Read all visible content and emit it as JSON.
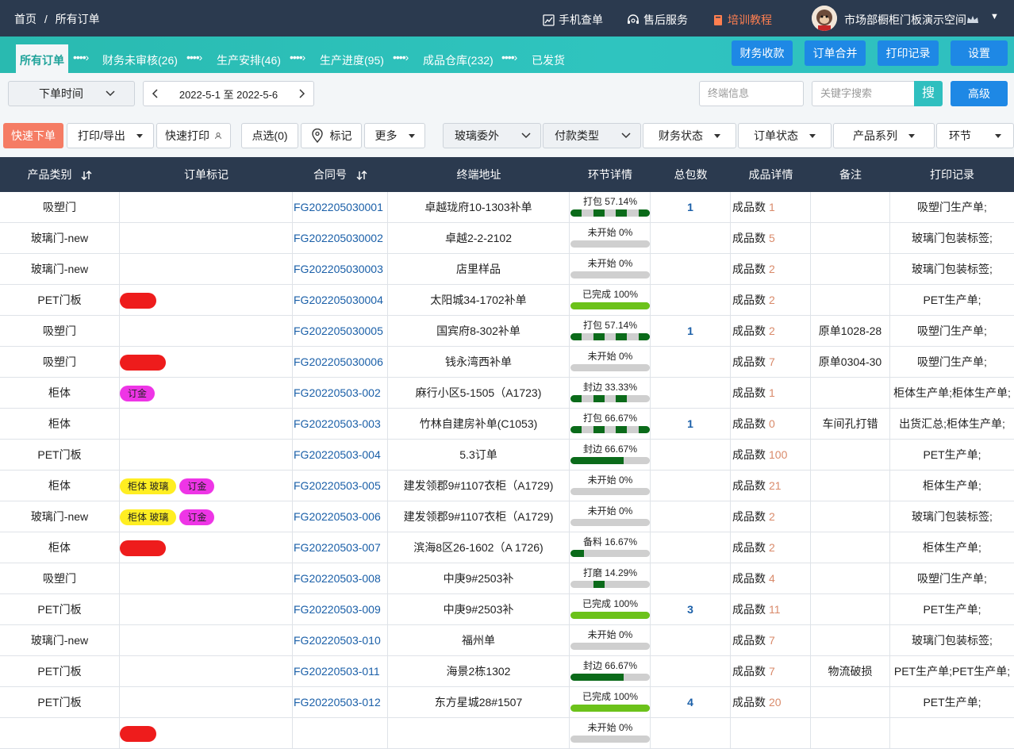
{
  "top": {
    "breadcrumb": [
      "首页",
      "/",
      "所有订单"
    ],
    "mobile": "手机查单",
    "service": "售后服务",
    "training": "培训教程",
    "user": "市场部橱柜门板演示空间"
  },
  "flow": {
    "steps": [
      {
        "label": "所有订单"
      },
      {
        "label": "财务未审核(26)"
      },
      {
        "label": "生产安排(46)"
      },
      {
        "label": "生产进度(95)"
      },
      {
        "label": "成品仓库(232)"
      },
      {
        "label": "已发货"
      }
    ],
    "buttons": [
      "财务收款",
      "订单合并",
      "打印记录",
      "设置"
    ]
  },
  "filter": {
    "time_type": "下单时间",
    "date_range": "2022-5-1 至 2022-5-6",
    "terminal_placeholder": "终端信息",
    "keyword_placeholder": "关键字搜索",
    "search_label": "搜",
    "advanced": "高级"
  },
  "actions": {
    "quick_order": "快速下单",
    "print_export": "打印/导出",
    "quick_print": "快速打印",
    "select": "点选(0)",
    "mark": "标记",
    "more": "更多",
    "glass": "玻璃委外",
    "pay_type": "付款类型",
    "finance_status": "财务状态",
    "order_status": "订单状态",
    "product_series": "产品系列",
    "stage": "环节"
  },
  "colors": {
    "header": "#2b3a4f",
    "flow_start": "#29bab0",
    "primary_button": "#1e88e5",
    "quick_order": "#f57c64",
    "progress_dark": "#0b6b1a",
    "progress_done": "#6cc21a"
  },
  "table": {
    "headers": [
      "产品类别",
      "订单标记",
      "合同号",
      "终端地址",
      "环节详情",
      "总包数",
      "成品详情",
      "备注",
      "打印记录"
    ],
    "qty_label": "成品数",
    "rows": [
      {
        "category": "吸塑门",
        "tags": [],
        "contract": "FG202205030001",
        "address": "卓越珑府10-1303补单",
        "stage": "打包 57.14%",
        "pct": 57.14,
        "style": "segmented",
        "total": "1",
        "qty": "1",
        "note": "",
        "print": "吸塑门生产单;"
      },
      {
        "category": "玻璃门-new",
        "tags": [],
        "contract": "FG202205030002",
        "address": "卓越2-2-2102",
        "stage": "未开始 0%",
        "pct": 0,
        "style": "solid",
        "total": "",
        "qty": "5",
        "note": "",
        "print": "玻璃门包装标签;"
      },
      {
        "category": "玻璃门-new",
        "tags": [],
        "contract": "FG202205030003",
        "address": "店里样品",
        "stage": "未开始 0%",
        "pct": 0,
        "style": "solid",
        "total": "",
        "qty": "2",
        "note": "",
        "print": "玻璃门包装标签;"
      },
      {
        "category": "PET门板",
        "tags": [
          {
            "text": " ",
            "color": "red"
          }
        ],
        "contract": "FG202205030004",
        "address": "太阳城34-1702补单",
        "stage": "已完成 100%",
        "pct": 100,
        "style": "done",
        "total": "",
        "qty": "2",
        "note": "",
        "print": "PET生产单;"
      },
      {
        "category": "吸塑门",
        "tags": [],
        "contract": "FG202205030005",
        "address": "国宾府8-302补单",
        "stage": "打包 57.14%",
        "pct": 57.14,
        "style": "segmented",
        "total": "1",
        "qty": "2",
        "note": "原单1028-28",
        "print": "吸塑门生产单;"
      },
      {
        "category": "吸塑门",
        "tags": [
          {
            "text": " ",
            "color": "red"
          }
        ],
        "contract": "FG202205030006",
        "address": "钱永湾西补单",
        "stage": "未开始 0%",
        "pct": 0,
        "style": "solid",
        "total": "",
        "qty": "7",
        "note": "原单0304-30",
        "print": "吸塑门生产单;"
      },
      {
        "category": "柜体",
        "tags": [
          {
            "text": "订金",
            "color": "mag"
          }
        ],
        "contract": "FG20220503-002",
        "address": "麻行小区5-1505（A1723)",
        "stage": "封边 33.33%",
        "pct": 33.33,
        "style": "segmented",
        "total": "",
        "qty": "1",
        "note": "",
        "print": "柜体生产单;柜体生产单;"
      },
      {
        "category": "柜体",
        "tags": [],
        "contract": "FG20220503-003",
        "address": "竹林自建房补单(C1053)",
        "stage": "打包 66.67%",
        "pct": 66.67,
        "style": "segmented",
        "total": "1",
        "qty": "0",
        "note": "车间孔打错",
        "print": "出货汇总;柜体生产单;"
      },
      {
        "category": "PET门板",
        "tags": [],
        "contract": "FG20220503-004",
        "address": "5.3订单",
        "stage": "封边 66.67%",
        "pct": 66.67,
        "style": "solid",
        "total": "",
        "qty": "100",
        "note": "",
        "print": "PET生产单;"
      },
      {
        "category": "柜体",
        "tags": [
          {
            "text": "柜体 玻璃",
            "color": "yel"
          },
          {
            "text": "订金",
            "color": "mag"
          }
        ],
        "contract": "FG20220503-005",
        "address": "建发领郡9#1107衣柜（A1729)",
        "stage": "未开始 0%",
        "pct": 0,
        "style": "solid",
        "total": "",
        "qty": "21",
        "note": "",
        "print": "柜体生产单;"
      },
      {
        "category": "玻璃门-new",
        "tags": [
          {
            "text": "柜体 玻璃",
            "color": "yel"
          },
          {
            "text": "订金",
            "color": "mag"
          }
        ],
        "contract": "FG20220503-006",
        "address": "建发领郡9#1107衣柜（A1729)",
        "stage": "未开始 0%",
        "pct": 0,
        "style": "solid",
        "total": "",
        "qty": "2",
        "note": "",
        "print": "玻璃门包装标签;"
      },
      {
        "category": "柜体",
        "tags": [
          {
            "text": " ",
            "color": "red"
          }
        ],
        "contract": "FG20220503-007",
        "address": "滨海8区26-1602（A 1726)",
        "stage": "备料 16.67%",
        "pct": 16.67,
        "style": "solid",
        "total": "",
        "qty": "2",
        "note": "",
        "print": "柜体生产单;"
      },
      {
        "category": "吸塑门",
        "tags": [],
        "contract": "FG20220503-008",
        "address": "中庚9#2503补",
        "stage": "打磨 14.29%",
        "pct": 14.29,
        "style": "block",
        "total": "",
        "qty": "4",
        "note": "",
        "print": "吸塑门生产单;"
      },
      {
        "category": "PET门板",
        "tags": [],
        "contract": "FG20220503-009",
        "address": "中庚9#2503补",
        "stage": "已完成 100%",
        "pct": 100,
        "style": "done",
        "total": "3",
        "qty": "11",
        "note": "",
        "print": "PET生产单;"
      },
      {
        "category": "玻璃门-new",
        "tags": [],
        "contract": "FG20220503-010",
        "address": "福州单",
        "stage": "未开始 0%",
        "pct": 0,
        "style": "solid",
        "total": "",
        "qty": "7",
        "note": "",
        "print": "玻璃门包装标签;"
      },
      {
        "category": "PET门板",
        "tags": [],
        "contract": "FG20220503-011",
        "address": "海景2栋1302",
        "stage": "封边 66.67%",
        "pct": 66.67,
        "style": "solid",
        "total": "",
        "qty": "7",
        "note": "物流破损",
        "print": "PET生产单;PET生产单;"
      },
      {
        "category": "PET门板",
        "tags": [],
        "contract": "FG20220503-012",
        "address": "东方星城28#1507",
        "stage": "已完成 100%",
        "pct": 100,
        "style": "done",
        "total": "4",
        "qty": "20",
        "note": "",
        "print": "PET生产单;"
      },
      {
        "category": "",
        "tags": [
          {
            "text": " ",
            "color": "red"
          }
        ],
        "contract": "",
        "address": "",
        "stage": "未开始 0%",
        "pct": 0,
        "style": "solid",
        "total": "",
        "qty": "",
        "note": "",
        "print": ""
      }
    ]
  }
}
